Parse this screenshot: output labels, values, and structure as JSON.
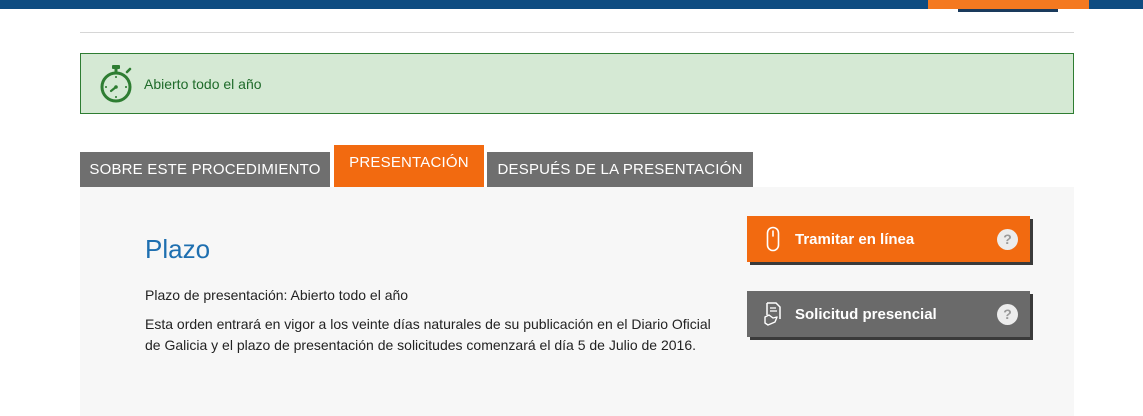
{
  "status": {
    "text": "Abierto todo el año",
    "icon": "stopwatch-icon"
  },
  "tabs": [
    {
      "label": "SOBRE ESTE PROCEDIMIENTO",
      "active": false
    },
    {
      "label": "PRESENTACIÓN",
      "active": true
    },
    {
      "label": "DESPUÉS DE LA PRESENTACIÓN",
      "active": false
    }
  ],
  "content": {
    "title": "Plazo",
    "paragraph_1": "Plazo de presentación: Abierto todo el año",
    "paragraph_2": "Esta orden entrará en vigor a los veinte días naturales de su publicación en el Diario Oficial de Galicia y el plazo de presentación de solicitudes comenzará el día 5 de Julio de 2016."
  },
  "actions": {
    "online_label": "Tramitar en línea",
    "presencial_label": "Solicitud presencial",
    "help_symbol": "?"
  },
  "colors": {
    "accent": "#f26a10",
    "header_blue": "#0f4c81",
    "tab_gray": "#6f6f6f",
    "status_green": "#d5e9d4",
    "title_blue": "#1e6fb0"
  }
}
